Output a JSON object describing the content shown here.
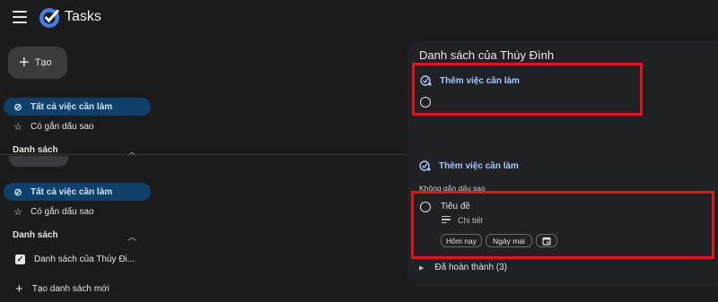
{
  "app": {
    "title": "Tasks",
    "icons": {
      "menu": "menu-icon",
      "logo": "tasks-logo-icon"
    }
  },
  "create_button": {
    "label": "Tạo"
  },
  "sidebar_top": {
    "items": [
      {
        "label": "Tất cả việc cần làm",
        "icon": "task-check-icon",
        "active": true
      },
      {
        "label": "Có gắn dấu sao",
        "icon": "star-icon",
        "active": false
      }
    ],
    "section_label": "Danh sách"
  },
  "sidebar_bottom": {
    "items": [
      {
        "label": "Tất cả việc cần làm",
        "icon": "task-check-icon",
        "active": true
      },
      {
        "label": "Có gắn dấu sao",
        "icon": "star-icon",
        "active": false
      }
    ],
    "section_label": "Danh sách",
    "lists": [
      {
        "label": "Danh sách của Thúy Đi...",
        "checked": true
      }
    ],
    "new_list_label": "Tạo danh sách mới"
  },
  "panel": {
    "title": "Danh sách của Thúy Đình",
    "add_task_label": "Thêm việc cần làm",
    "add_task_label_2": "Thêm việc cần làm",
    "group_label": "Không gắn dấu sao",
    "task": {
      "title_placeholder": "Tiêu đề",
      "details_placeholder": "Chi tiết",
      "chips": [
        "Hôm nay",
        "Ngày mai"
      ]
    },
    "completed_label": "Đã hoàn thành (3)"
  },
  "colors": {
    "background": "#1b1b1c",
    "accent": "#a8c7fa",
    "active_bg": "#0e4069",
    "highlight": "#e1141c"
  }
}
